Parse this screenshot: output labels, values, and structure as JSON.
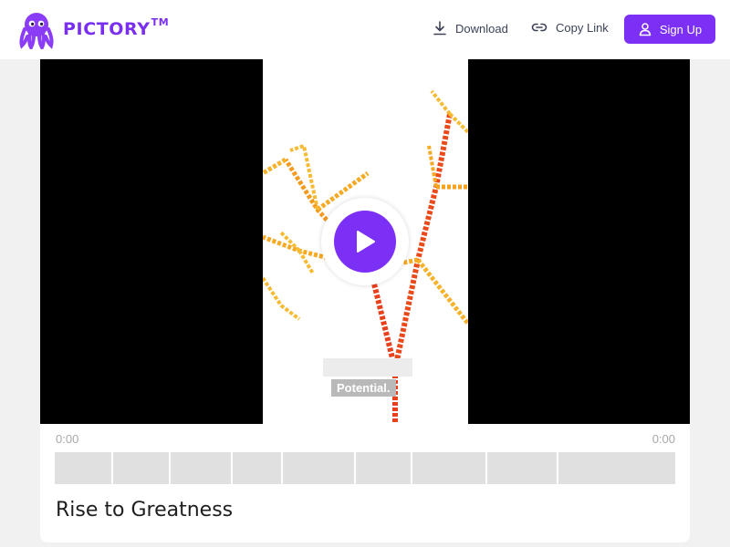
{
  "brand": {
    "name": "PICTORY",
    "trademark": "TM",
    "color": "#7a2ff0"
  },
  "header": {
    "download_label": "Download",
    "copy_link_label": "Copy Link",
    "signup_label": "Sign Up"
  },
  "player": {
    "caption_text": "Potential.",
    "time_current": "0:00",
    "time_total": "0:00",
    "accent_color": "#7c2ff5"
  },
  "video": {
    "title": "Rise to Greatness"
  },
  "icons": {
    "download": "download-icon",
    "copy_link": "link-icon",
    "user": "user-icon",
    "play": "play-icon"
  }
}
